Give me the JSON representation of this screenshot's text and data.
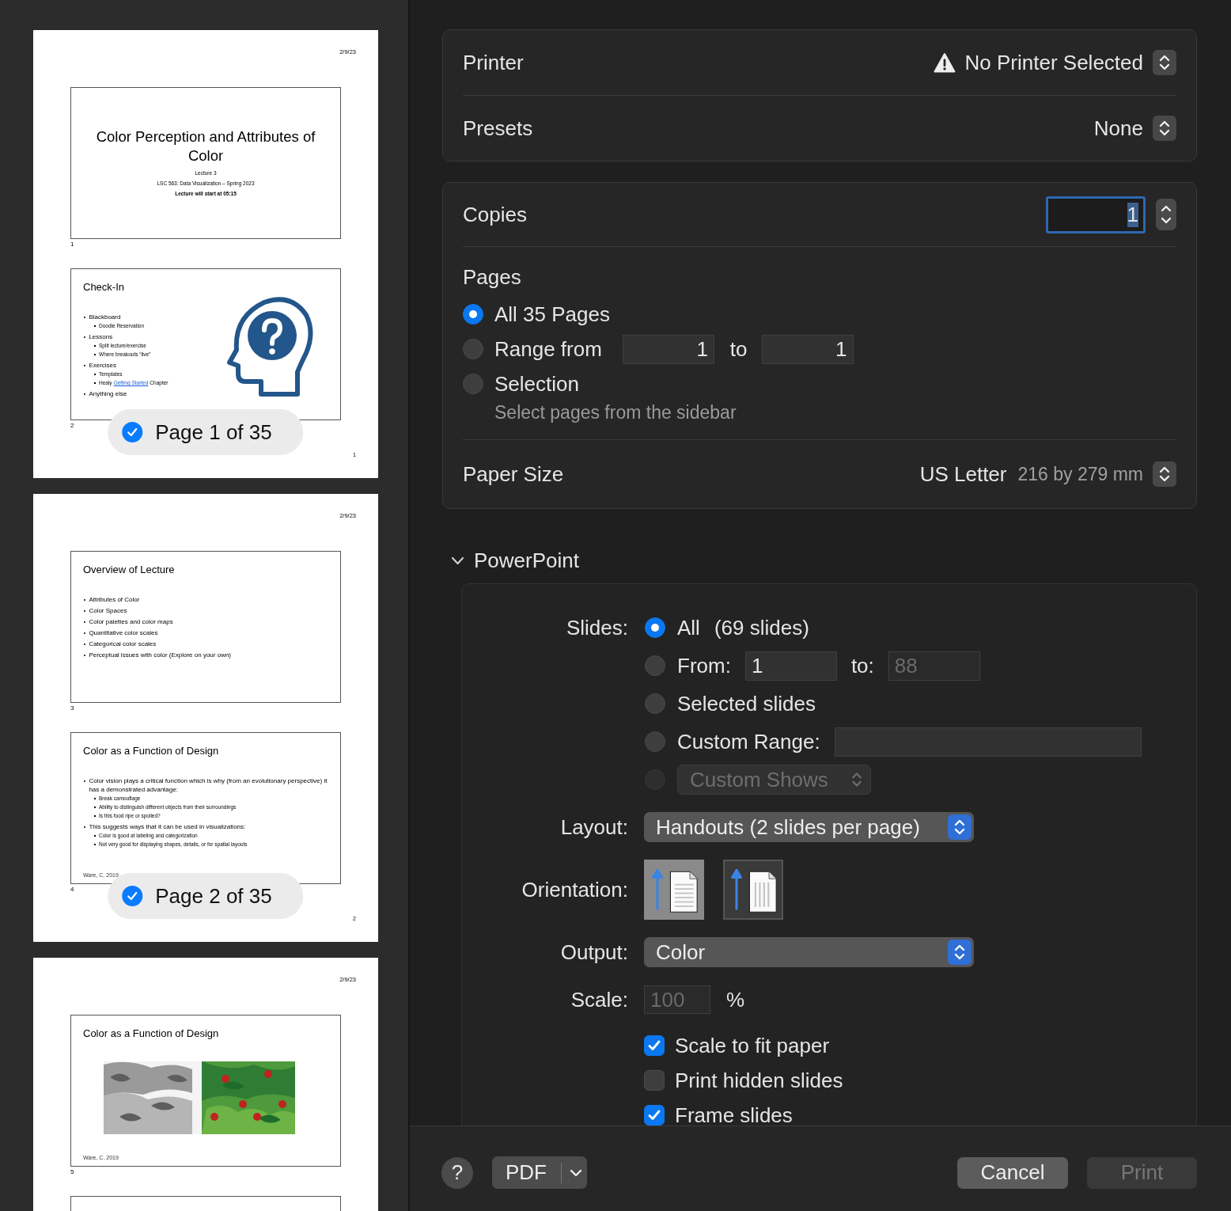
{
  "sidebar": {
    "pages": [
      {
        "date": "2/9/23",
        "page_number": "1",
        "badge": {
          "label": "Page 1 of 35",
          "checked": true
        },
        "slides": [
          {
            "kind": "title",
            "number": "1",
            "title": "Color Perception and Attributes of Color",
            "lines": [
              "Lecture 3",
              "LSC 563: Data Visualization – Spring 2023"
            ],
            "note": "Lecture will start at 05:15"
          },
          {
            "kind": "bullets-icon",
            "number": "2",
            "title": "Check-In",
            "bullets": [
              {
                "text": "Blackboard",
                "children": [
                  {
                    "text": "Doodle Reservation"
                  }
                ]
              },
              {
                "text": "Lessons",
                "children": [
                  {
                    "text": "Split lecture/exercise"
                  },
                  {
                    "text": "Where breakouts “live”"
                  }
                ]
              },
              {
                "text": "Exercises",
                "children": [
                  {
                    "text": "Templates"
                  },
                  {
                    "text": "Healy",
                    "link": "Getting Started",
                    "tail": "Chapter"
                  }
                ]
              },
              {
                "text": "Anything else"
              }
            ]
          }
        ]
      },
      {
        "date": "2/9/23",
        "page_number": "2",
        "badge": {
          "label": "Page 2 of 35",
          "checked": true
        },
        "slides": [
          {
            "kind": "bullets",
            "number": "3",
            "title": "Overview of Lecture",
            "bullets": [
              {
                "text": "Attributes of Color"
              },
              {
                "text": "Color Spaces"
              },
              {
                "text": "Color palettes and color maps"
              },
              {
                "text": "Quantitative color scales"
              },
              {
                "text": "Categorical color scales"
              },
              {
                "text": "Perceptual issues with color (Explore on your own)"
              }
            ]
          },
          {
            "kind": "bullets",
            "number": "4",
            "title": "Color as a Function of Design",
            "footnote": "Ware, C. 2019",
            "bullets": [
              {
                "text": "Color vision plays a critical function which is why (from an evolutionary perspective) it has a demonstrated advantage:",
                "children": [
                  {
                    "text": "Break camouflage"
                  },
                  {
                    "text": "Ability to distinguish different objects from their surroundings"
                  },
                  {
                    "text": "Is this food ripe or spoiled?"
                  }
                ]
              },
              {
                "text": "This suggests ways that it can be used in visualizations:",
                "children": [
                  {
                    "text": "Color is good at labeling and categorization"
                  },
                  {
                    "text": "Not very good for displaying shapes, details, or for spatial layouts"
                  }
                ]
              }
            ]
          }
        ]
      },
      {
        "date": "2/9/23",
        "slides": [
          {
            "kind": "picture",
            "number": "5",
            "title": "Color as a Function of Design",
            "footnote": "Ware, C. 2019"
          },
          {
            "kind": "blank"
          }
        ]
      }
    ]
  },
  "printer": {
    "label": "Printer",
    "value": "No Printer Selected",
    "warning": true
  },
  "presets": {
    "label": "Presets",
    "value": "None"
  },
  "copies": {
    "label": "Copies",
    "value": "1"
  },
  "pages": {
    "label": "Pages",
    "options": [
      {
        "kind": "plain",
        "label": "All 35 Pages",
        "selected": true
      },
      {
        "kind": "range",
        "label": "Range from",
        "from": "1",
        "to_label": "to",
        "to": "1",
        "selected": false
      },
      {
        "kind": "plain",
        "label": "Selection",
        "hint": "Select pages from the sidebar",
        "selected": false
      }
    ]
  },
  "paper_size": {
    "label": "Paper Size",
    "value": "US Letter",
    "detail": "216 by 279 mm"
  },
  "powerpoint": {
    "title": "PowerPoint",
    "expanded": true,
    "slides": {
      "label": "Slides:",
      "options": [
        {
          "kind": "plain",
          "label": "All",
          "detail": "(69 slides)",
          "selected": true
        },
        {
          "kind": "range",
          "label": "From:",
          "from": "1",
          "to_label": "to:",
          "to": "88",
          "to_disabled": true,
          "selected": false
        },
        {
          "kind": "plain",
          "label": "Selected slides",
          "selected": false
        },
        {
          "kind": "field",
          "label": "Custom Range:",
          "selected": false
        },
        {
          "kind": "popup",
          "label": "Custom Shows",
          "selected": false,
          "disabled": true
        }
      ]
    },
    "layout": {
      "label": "Layout:",
      "value": "Handouts (2 slides per page)"
    },
    "orientation": {
      "label": "Orientation:",
      "options": [
        {
          "kind": "portrait",
          "selected": true
        },
        {
          "kind": "landscape",
          "selected": false
        }
      ]
    },
    "output": {
      "label": "Output:",
      "value": "Color"
    },
    "scale": {
      "label": "Scale:",
      "value": "100",
      "unit": "%",
      "disabled": true
    },
    "checkboxes": [
      {
        "label": "Scale to fit paper",
        "checked": true
      },
      {
        "label": "Print hidden slides",
        "checked": false
      },
      {
        "label": "Frame slides",
        "checked": true
      }
    ]
  },
  "footer": {
    "help": "?",
    "pdf": "PDF",
    "cancel": "Cancel",
    "print": {
      "label": "Print",
      "disabled": true
    }
  }
}
